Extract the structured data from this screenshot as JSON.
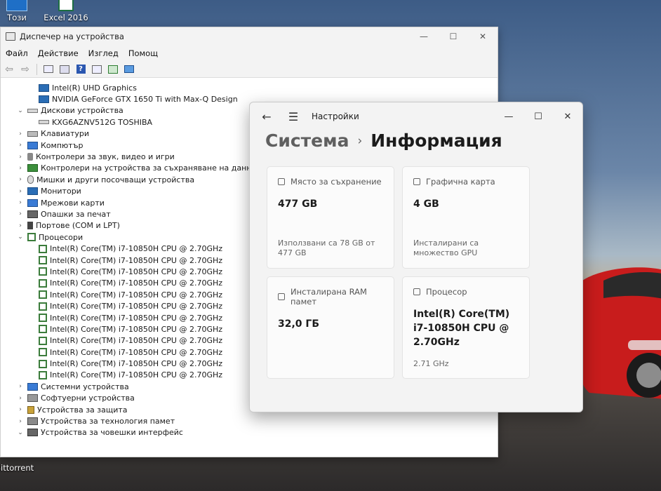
{
  "desktop": {
    "icons": [
      {
        "label": "Този"
      },
      {
        "label": "Excel 2016"
      },
      {
        "label": "qBittorrent"
      }
    ]
  },
  "device_manager": {
    "title": "Диспечер на устройства",
    "menu": [
      "Файл",
      "Действие",
      "Изглед",
      "Помощ"
    ],
    "tree": [
      {
        "level": 1,
        "expanded": null,
        "icon": "monitor-icon",
        "label": "Intel(R) UHD Graphics"
      },
      {
        "level": 1,
        "expanded": null,
        "icon": "monitor-icon",
        "label": "NVIDIA GeForce GTX 1650 Ti with Max-Q Design"
      },
      {
        "level": 0,
        "expanded": true,
        "icon": "disk-drive-icon",
        "label": "Дискови устройства"
      },
      {
        "level": 1,
        "expanded": null,
        "icon": "disk-drive-icon",
        "label": "KXG6AZNV512G TOSHIBA"
      },
      {
        "level": 0,
        "expanded": false,
        "icon": "keyboard-icon",
        "label": "Клавиатури"
      },
      {
        "level": 0,
        "expanded": false,
        "icon": "computer-icon",
        "label": "Компютър"
      },
      {
        "level": 0,
        "expanded": false,
        "icon": "sound-icon",
        "label": "Контролери за звук, видео и игри"
      },
      {
        "level": 0,
        "expanded": false,
        "icon": "storage-controller-icon",
        "label": "Контролери на устройства за съхраняване на данни"
      },
      {
        "level": 0,
        "expanded": false,
        "icon": "mouse-icon",
        "label": "Мишки и други посочващи устройства"
      },
      {
        "level": 0,
        "expanded": false,
        "icon": "monitor-icon",
        "label": "Монитори"
      },
      {
        "level": 0,
        "expanded": false,
        "icon": "network-icon",
        "label": "Мрежови карти"
      },
      {
        "level": 0,
        "expanded": false,
        "icon": "printer-icon",
        "label": "Опашки за печат"
      },
      {
        "level": 0,
        "expanded": false,
        "icon": "port-icon",
        "label": "Портове (COM и LPT)"
      },
      {
        "level": 0,
        "expanded": true,
        "icon": "processor-icon",
        "label": "Процесори"
      },
      {
        "level": 1,
        "expanded": null,
        "icon": "processor-icon",
        "label": "Intel(R) Core(TM) i7-10850H CPU @ 2.70GHz"
      },
      {
        "level": 1,
        "expanded": null,
        "icon": "processor-icon",
        "label": "Intel(R) Core(TM) i7-10850H CPU @ 2.70GHz"
      },
      {
        "level": 1,
        "expanded": null,
        "icon": "processor-icon",
        "label": "Intel(R) Core(TM) i7-10850H CPU @ 2.70GHz"
      },
      {
        "level": 1,
        "expanded": null,
        "icon": "processor-icon",
        "label": "Intel(R) Core(TM) i7-10850H CPU @ 2.70GHz"
      },
      {
        "level": 1,
        "expanded": null,
        "icon": "processor-icon",
        "label": "Intel(R) Core(TM) i7-10850H CPU @ 2.70GHz"
      },
      {
        "level": 1,
        "expanded": null,
        "icon": "processor-icon",
        "label": "Intel(R) Core(TM) i7-10850H CPU @ 2.70GHz"
      },
      {
        "level": 1,
        "expanded": null,
        "icon": "processor-icon",
        "label": "Intel(R) Core(TM) i7-10850H CPU @ 2.70GHz"
      },
      {
        "level": 1,
        "expanded": null,
        "icon": "processor-icon",
        "label": "Intel(R) Core(TM) i7-10850H CPU @ 2.70GHz"
      },
      {
        "level": 1,
        "expanded": null,
        "icon": "processor-icon",
        "label": "Intel(R) Core(TM) i7-10850H CPU @ 2.70GHz"
      },
      {
        "level": 1,
        "expanded": null,
        "icon": "processor-icon",
        "label": "Intel(R) Core(TM) i7-10850H CPU @ 2.70GHz"
      },
      {
        "level": 1,
        "expanded": null,
        "icon": "processor-icon",
        "label": "Intel(R) Core(TM) i7-10850H CPU @ 2.70GHz"
      },
      {
        "level": 1,
        "expanded": null,
        "icon": "processor-icon",
        "label": "Intel(R) Core(TM) i7-10850H CPU @ 2.70GHz"
      },
      {
        "level": 0,
        "expanded": false,
        "icon": "system-devices-icon",
        "label": "Системни устройства"
      },
      {
        "level": 0,
        "expanded": false,
        "icon": "software-devices-icon",
        "label": "Софтуерни устройства"
      },
      {
        "level": 0,
        "expanded": false,
        "icon": "security-devices-icon",
        "label": "Устройства за защита"
      },
      {
        "level": 0,
        "expanded": false,
        "icon": "memory-technology-icon",
        "label": "Устройства за технология памет"
      },
      {
        "level": 0,
        "expanded": true,
        "icon": "hid-icon",
        "label": "Устройства за човешки интерфейс"
      }
    ]
  },
  "settings": {
    "app_title": "Настройки",
    "breadcrumb": {
      "parent": "Система",
      "current": "Информация"
    },
    "cards": {
      "storage": {
        "icon": "storage-icon",
        "title": "Място за съхранение",
        "value": "477 GB",
        "detail": "Използвани са 78 GB от 477 GB"
      },
      "gpu": {
        "icon": "graphics-card-icon",
        "title": "Графична карта",
        "value": "4 GB",
        "detail": "Инсталирани са множество GPU"
      },
      "ram": {
        "icon": "ram-icon",
        "title": "Инсталирана RAM памет",
        "value": "32,0 ГБ"
      },
      "cpu": {
        "icon": "processor-icon",
        "title": "Процесор",
        "value": "Intel(R) Core(TM) i7-10850H CPU @ 2.70GHz",
        "detail": "2.71 GHz"
      }
    }
  }
}
